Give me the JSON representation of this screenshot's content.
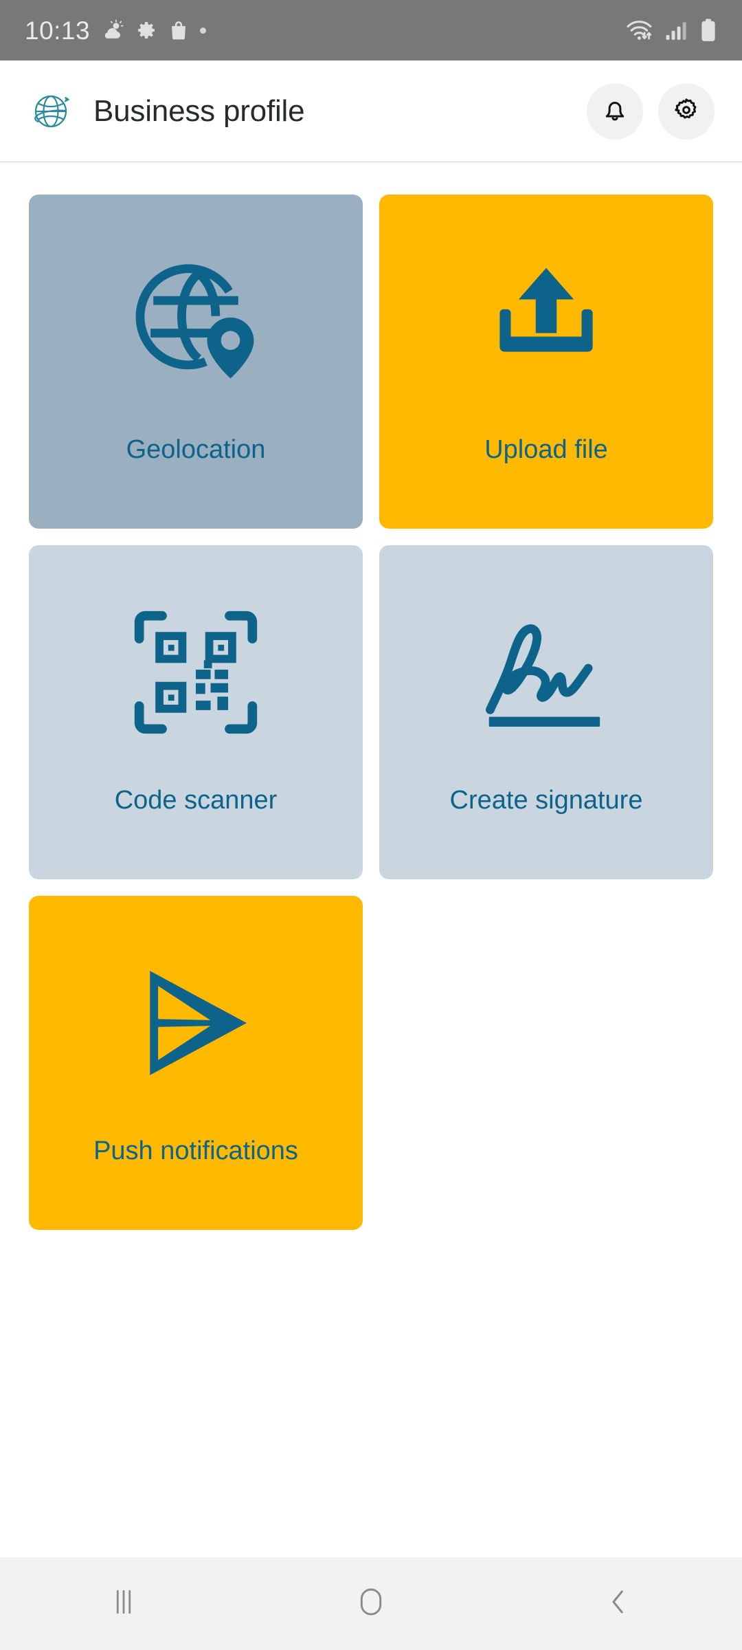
{
  "status_bar": {
    "time": "10:13",
    "left_icons": [
      "weather-partly-cloudy-icon",
      "settings-gear-icon",
      "shopping-bag-icon",
      "more-dot-icon"
    ],
    "right_icons": [
      "wifi-data-transfer-icon",
      "cellular-signal-icon",
      "battery-full-icon"
    ],
    "background_color": "#787878",
    "foreground_color": "#eaeaea"
  },
  "header": {
    "title": "Business profile",
    "logo_icon": "globe-orbit-logo",
    "logo_color": "#2a8a9e",
    "title_color": "#262b2e",
    "actions": [
      {
        "name": "notifications",
        "icon": "bell-icon",
        "label": "Notifications"
      },
      {
        "name": "settings",
        "icon": "gear-icon",
        "label": "Settings"
      }
    ]
  },
  "theme": {
    "accent_blue": "#0d6389",
    "tile_yellow": "#FFB900",
    "tile_slate": "#9aafc0",
    "tile_light_blue": "#c9d6e0",
    "page_background": "#ffffff",
    "nav_background": "#f2f2f2"
  },
  "tiles": [
    {
      "label": "Geolocation",
      "icon": "globe-pin-icon",
      "bg": "#9aafc0",
      "fg": "#0d6389"
    },
    {
      "label": "Upload file",
      "icon": "upload-icon",
      "bg": "#FFB900",
      "fg": "#0d6389"
    },
    {
      "label": "Code scanner",
      "icon": "qr-scanner-icon",
      "bg": "#c9d6e0",
      "fg": "#0d6389"
    },
    {
      "label": "Create signature",
      "icon": "signature-icon",
      "bg": "#c9d6e0",
      "fg": "#0d6389"
    },
    {
      "label": "Push notifications",
      "icon": "send-plane-icon",
      "bg": "#FFB900",
      "fg": "#0d6389"
    }
  ],
  "nav_bar": {
    "buttons": [
      {
        "name": "recents",
        "icon": "recents-icon",
        "label": "Recents"
      },
      {
        "name": "home",
        "icon": "home-icon",
        "label": "Home"
      },
      {
        "name": "back",
        "icon": "back-icon",
        "label": "Back"
      }
    ]
  }
}
